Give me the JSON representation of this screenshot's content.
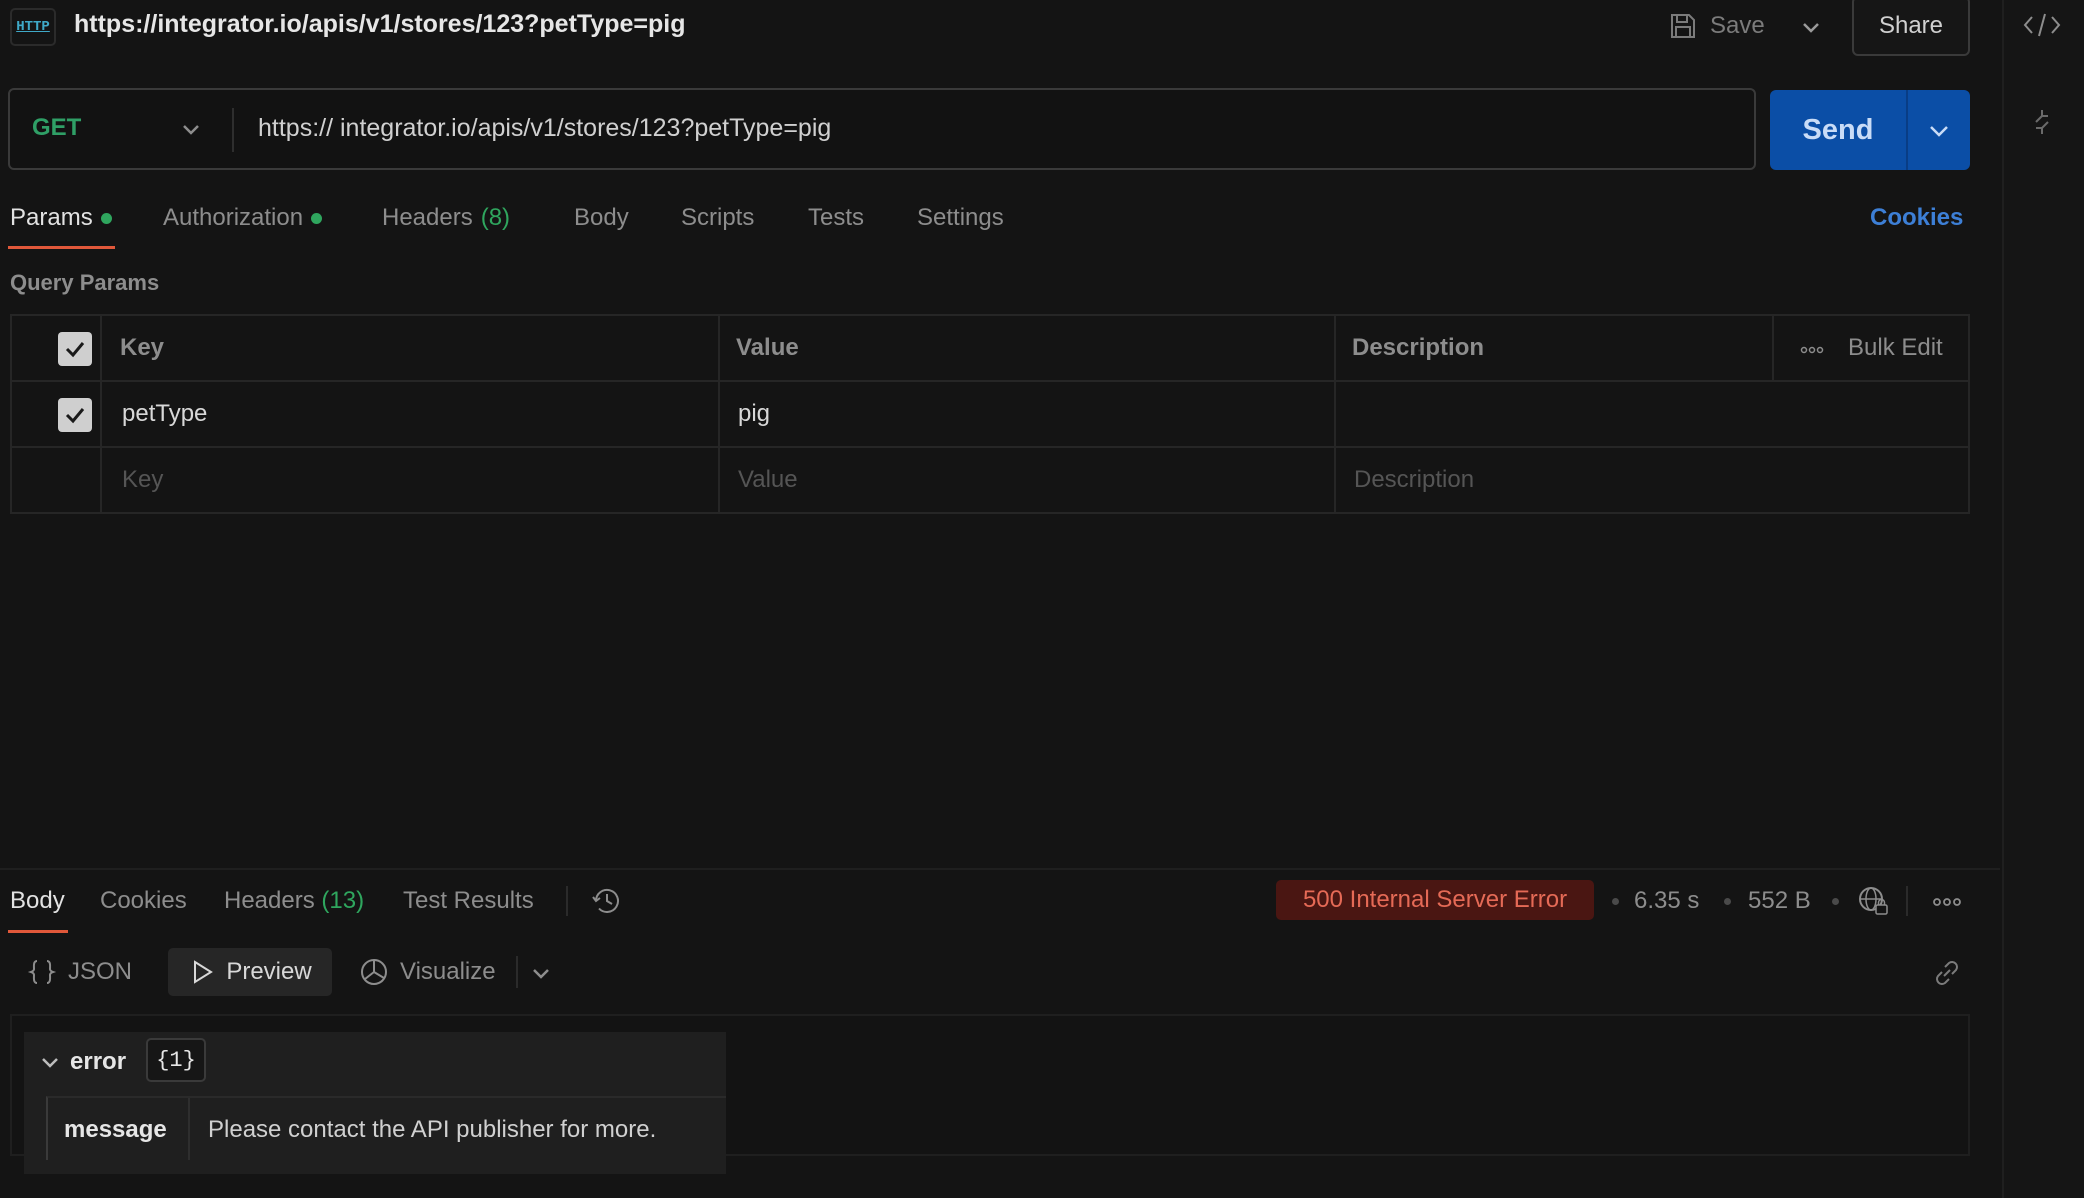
{
  "titlebar": {
    "badge": "HTTP",
    "url": "https://integrator.io/apis/v1/stores/123?petType=pig",
    "save_label": "Save",
    "share_label": "Share"
  },
  "request": {
    "method": "GET",
    "url": "https:// integrator.io/apis/v1/stores/123?petType=pig",
    "send_label": "Send"
  },
  "request_tabs": {
    "params": "Params",
    "authorization": "Authorization",
    "headers": "Headers",
    "headers_count": "(8)",
    "body": "Body",
    "scripts": "Scripts",
    "tests": "Tests",
    "settings": "Settings",
    "cookies": "Cookies"
  },
  "query_params": {
    "section_label": "Query Params",
    "columns": {
      "key": "Key",
      "value": "Value",
      "description": "Description"
    },
    "bulk_edit": "Bulk Edit",
    "rows": [
      {
        "checked": true,
        "key": "petType",
        "value": "pig",
        "description": ""
      }
    ],
    "placeholders": {
      "key": "Key",
      "value": "Value",
      "description": "Description"
    }
  },
  "response": {
    "tabs": {
      "body": "Body",
      "cookies": "Cookies",
      "headers": "Headers",
      "headers_count": "(13)",
      "test_results": "Test Results"
    },
    "status": "500 Internal Server Error",
    "time": "6.35 s",
    "size": "552 B",
    "view": {
      "json": "JSON",
      "preview": "Preview",
      "visualize": "Visualize"
    },
    "body": {
      "root_key": "error",
      "root_count": "{1}",
      "child_key": "message",
      "child_value": "Please contact the API publisher for more."
    }
  },
  "colors": {
    "accent_send": "#0b4ea6",
    "method_get": "#2f9f66",
    "active_tab_underline": "#e0583a",
    "status_error_bg": "#4a1612",
    "status_error_text": "#e56a56",
    "link": "#3d7fd6"
  }
}
